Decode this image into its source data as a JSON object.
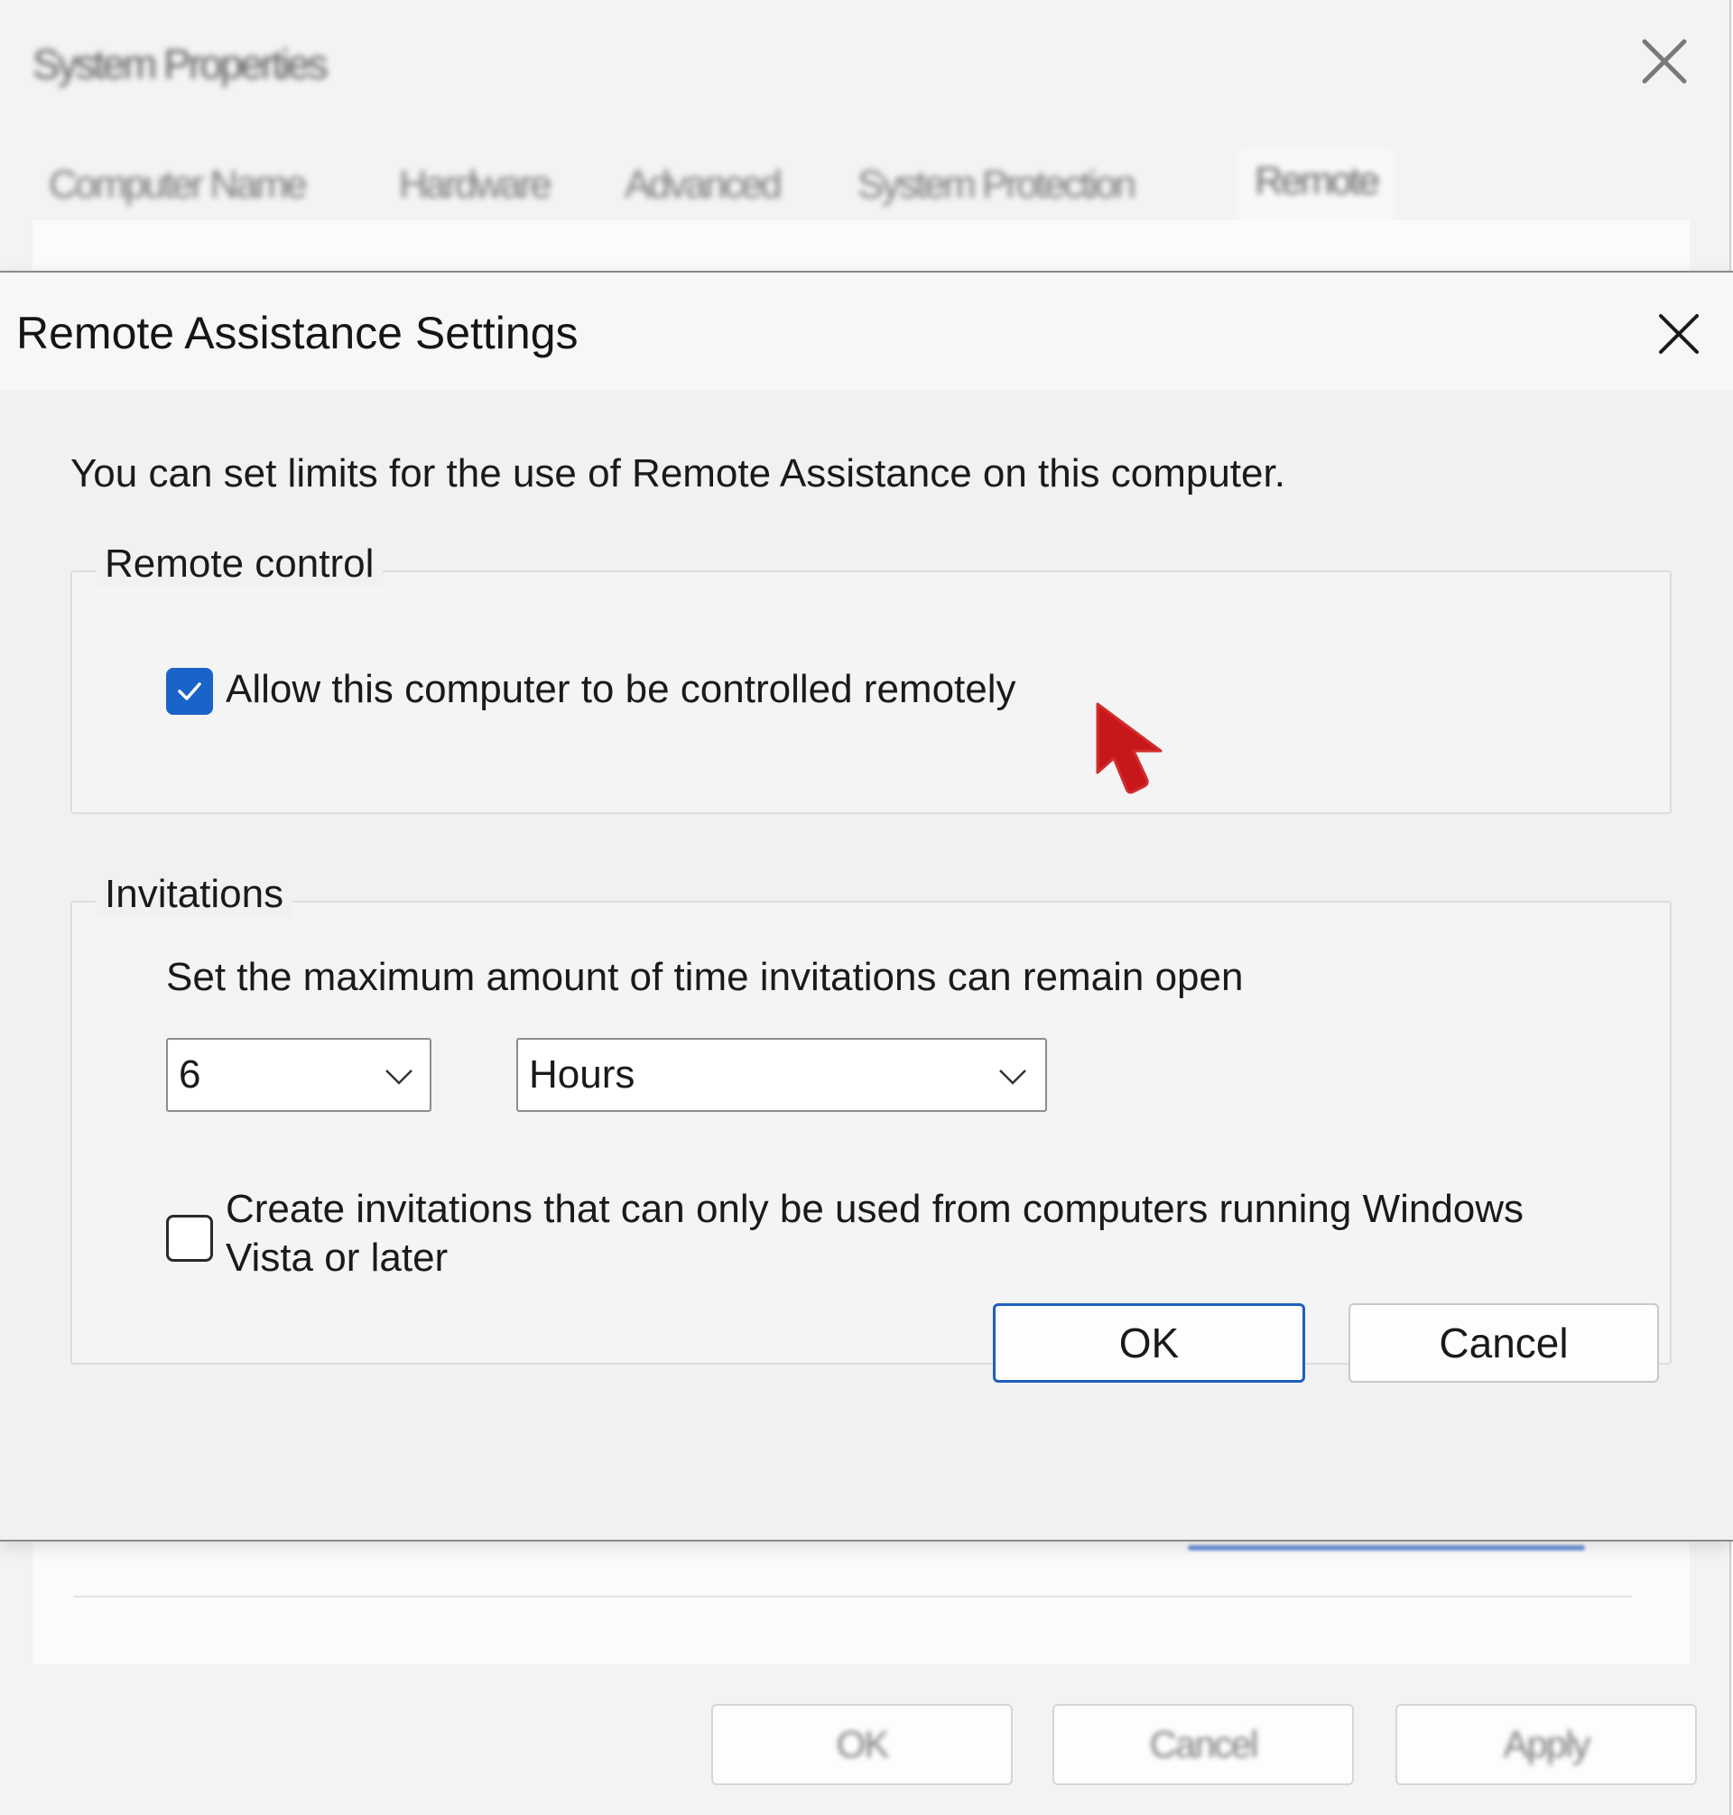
{
  "parent_window": {
    "title": "System Properties",
    "tabs": [
      {
        "label": "Computer Name"
      },
      {
        "label": "Hardware"
      },
      {
        "label": "Advanced"
      },
      {
        "label": "System Protection"
      },
      {
        "label": "Remote",
        "active": true
      }
    ],
    "buttons": {
      "ok": "OK",
      "cancel": "Cancel",
      "apply": "Apply"
    }
  },
  "dialog": {
    "title": "Remote Assistance Settings",
    "intro": "You can set limits for the use of Remote Assistance on this computer.",
    "remote_control": {
      "legend": "Remote control",
      "allow_label": "Allow this computer to be controlled remotely",
      "allow_checked": true
    },
    "invitations": {
      "legend": "Invitations",
      "description": "Set the maximum amount of time invitations can remain open",
      "duration_value": "6",
      "duration_unit": "Hours",
      "vista_line1": "Create invitations that can only be used from computers running Windows",
      "vista_line2": "Vista or later",
      "vista_checked": false
    },
    "buttons": {
      "ok": "OK",
      "cancel": "Cancel"
    }
  },
  "colors": {
    "accent": "#1a63c9",
    "cursor": "#c8171a",
    "dialog_bg": "#f1f1f1"
  },
  "icons": {
    "close": "close-icon",
    "chevron": "chevron-down-icon",
    "check": "checkmark-icon",
    "cursor": "mouse-pointer-icon"
  }
}
